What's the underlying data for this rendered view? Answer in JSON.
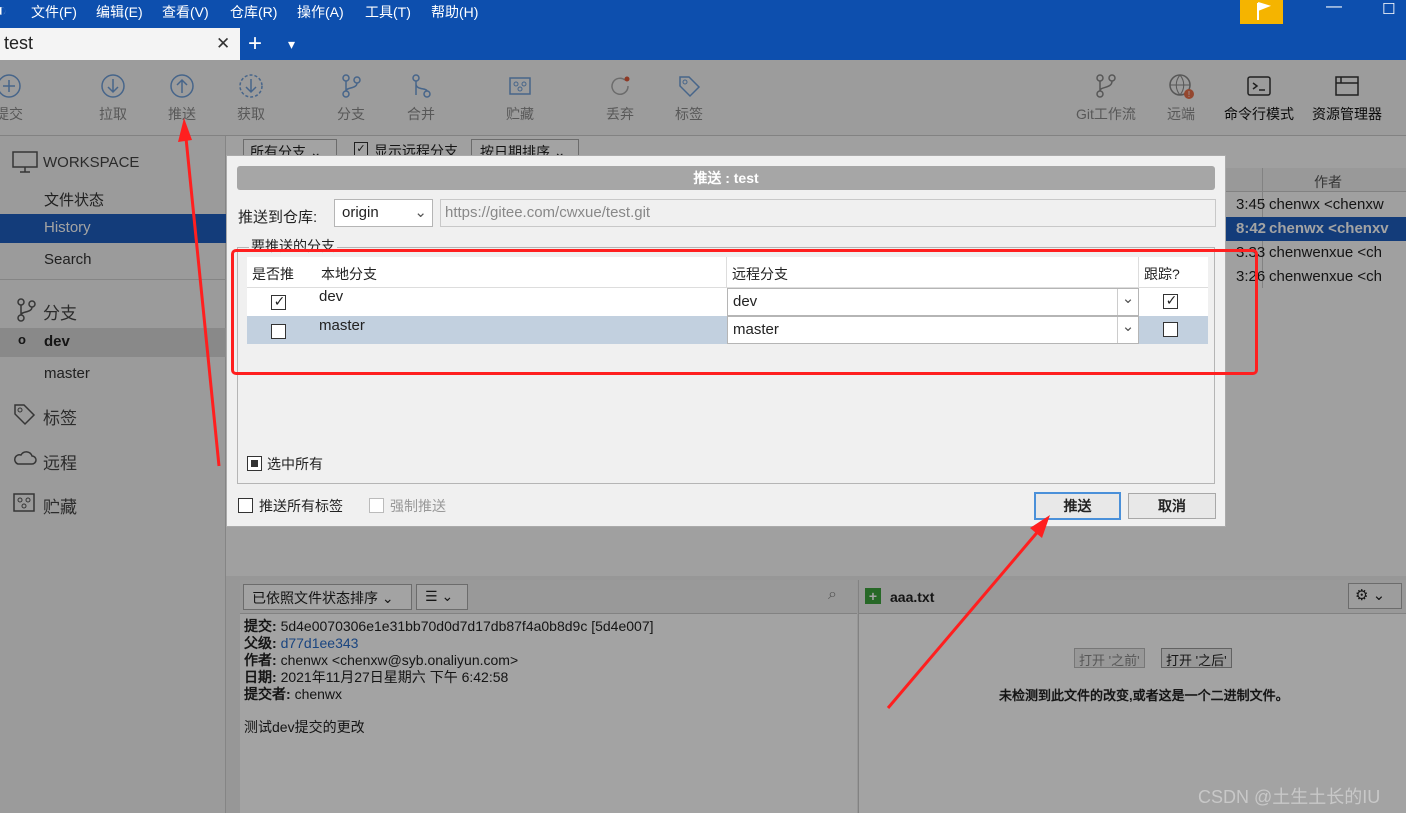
{
  "menu": [
    "文件(F)",
    "编辑(E)",
    "查看(V)",
    "仓库(R)",
    "操作(A)",
    "工具(T)",
    "帮助(H)"
  ],
  "tab": {
    "label": "test",
    "close": "✕",
    "add": "+",
    "dropdown": "▾"
  },
  "toolbar": {
    "commit": "提交",
    "pull": "拉取",
    "push": "推送",
    "fetch": "获取",
    "branch": "分支",
    "merge": "合并",
    "stash": "贮藏",
    "discard": "丢弃",
    "tag": "标签",
    "gitflow": "Git工作流",
    "remote": "远端",
    "terminal": "命令行模式",
    "explorer": "资源管理器"
  },
  "sidebar": {
    "workspace": "WORKSPACE",
    "file_status": "文件状态",
    "history": "History",
    "search": "Search",
    "branches": "分支",
    "branch_current": "dev",
    "branch_other": "master",
    "tags": "标签",
    "remotes": "远程",
    "stashes": "贮藏"
  },
  "filter": {
    "branches": "所有分支",
    "show_remote": "显示远程分支",
    "sort": "按日期排序"
  },
  "commits": {
    "author_header": "作者",
    "rows": [
      {
        "time": "3:45",
        "author": "chenwx <chenxw"
      },
      {
        "time": "8:42",
        "author": "chenwx <chenxv"
      },
      {
        "time": "3:33",
        "author": "chenwenxue <ch"
      },
      {
        "time": "3:26",
        "author": "chenwenxue <ch"
      }
    ]
  },
  "dialog": {
    "title": "推送 : test",
    "repo_label": "推送到仓库:",
    "repo_value": "origin",
    "repo_url": "https://gitee.com/cwxue/test.git",
    "group_label": "要推送的分支",
    "col_push": "是否推",
    "col_local": "本地分支",
    "col_remote": "远程分支",
    "col_track": "跟踪?",
    "rows": [
      {
        "local": "dev",
        "remote": "dev",
        "push": true,
        "track": true
      },
      {
        "local": "master",
        "remote": "master",
        "push": false,
        "track": false
      }
    ],
    "select_all": "选中所有",
    "push_all_tags": "推送所有标签",
    "force_push": "强制推送",
    "ok": "推送",
    "cancel": "取消"
  },
  "details": {
    "sort": "已依照文件状态排序",
    "commit_label": "提交:",
    "commit_value": "5d4e0070306e1e31bb70d0d7d17db87f4a0b8d9c [5d4e007]",
    "parent_label": "父级:",
    "parent_value": "d77d1ee343",
    "author_label": "作者:",
    "author_value": "chenwx <chenxw@syb.onaliyun.com>",
    "date_label": "日期:",
    "date_value": "2021年11月27日星期六 下午 6:42:58",
    "committer_label": "提交者:",
    "committer_value": "chenwx",
    "message": "测试dev提交的更改"
  },
  "diff": {
    "file": "aaa.txt",
    "open_before": "打开 '之前'",
    "open_after": "打开 '之后'",
    "no_change": "未检测到此文件的改变,或者这是一个二进制文件。"
  },
  "watermark": "CSDN @土生土长的IU",
  "colors": {
    "menubar": "#0d4fae",
    "selected": "#1f5fbf",
    "annotation": "#ff1f1f",
    "flag": "#f5b400"
  }
}
